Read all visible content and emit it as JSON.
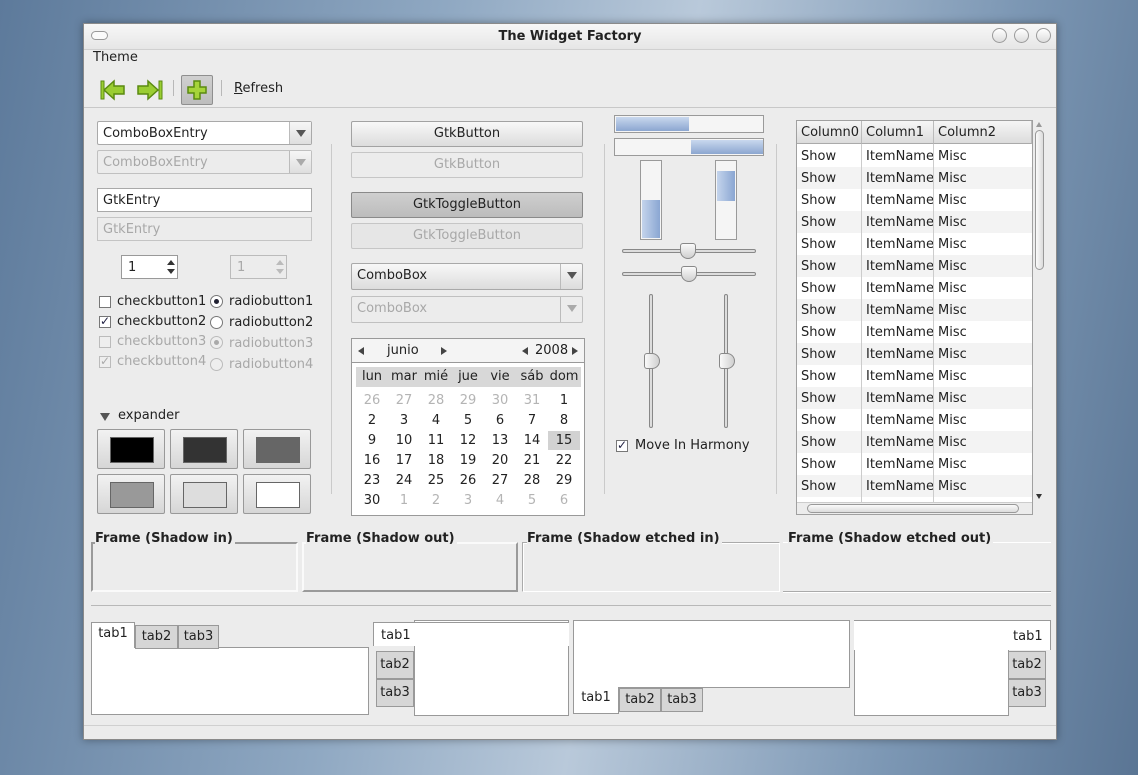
{
  "window": {
    "title": "The Widget Factory"
  },
  "menu": {
    "theme": "Theme"
  },
  "toolbar": {
    "refresh": "Refresh"
  },
  "left": {
    "combo1": "ComboBoxEntry",
    "combo2": "ComboBoxEntry",
    "entry1": "GtkEntry",
    "entry2": "GtkEntry",
    "spin1": "1",
    "spin2": "1",
    "check1": "checkbutton1",
    "check2": "checkbutton2",
    "check3": "checkbutton3",
    "check4": "checkbutton4",
    "radio1": "radiobutton1",
    "radio2": "radiobutton2",
    "radio3": "radiobutton3",
    "radio4": "radiobutton4",
    "expander": "expander",
    "swatch_colors": [
      "#000000",
      "#333333",
      "#666666",
      "#999999",
      "#dddddd",
      "#ffffff"
    ]
  },
  "middle": {
    "button1": "GtkButton",
    "button2": "GtkButton",
    "toggle1": "GtkToggleButton",
    "toggle2": "GtkToggleButton",
    "combo1": "ComboBox",
    "combo2": "ComboBox"
  },
  "calendar": {
    "month": "junio",
    "year": "2008",
    "days": [
      "lun",
      "mar",
      "mié",
      "jue",
      "vie",
      "sáb",
      "dom"
    ],
    "selected": "15",
    "weeks": [
      [
        "26",
        "27",
        "28",
        "29",
        "30",
        "31",
        "1"
      ],
      [
        "2",
        "3",
        "4",
        "5",
        "6",
        "7",
        "8"
      ],
      [
        "9",
        "10",
        "11",
        "12",
        "13",
        "14",
        "15"
      ],
      [
        "16",
        "17",
        "18",
        "19",
        "20",
        "21",
        "22"
      ],
      [
        "23",
        "24",
        "25",
        "26",
        "27",
        "28",
        "29"
      ],
      [
        "30",
        "1",
        "2",
        "3",
        "4",
        "5",
        "6"
      ]
    ]
  },
  "sliders": {
    "move_in_harmony": "Move In Harmony",
    "progress_h1": 0.5,
    "progress_v1": 0.5
  },
  "tree": {
    "columns": [
      "Column0",
      "Column1",
      "Column2"
    ],
    "rows": [
      [
        "Show",
        "ItemName",
        "Misc"
      ],
      [
        "Show",
        "ItemName",
        "Misc"
      ],
      [
        "Show",
        "ItemName",
        "Misc"
      ],
      [
        "Show",
        "ItemName",
        "Misc"
      ],
      [
        "Show",
        "ItemName",
        "Misc"
      ],
      [
        "Show",
        "ItemName",
        "Misc"
      ],
      [
        "Show",
        "ItemName",
        "Misc"
      ],
      [
        "Show",
        "ItemName",
        "Misc"
      ],
      [
        "Show",
        "ItemName",
        "Misc"
      ],
      [
        "Show",
        "ItemName",
        "Misc"
      ],
      [
        "Show",
        "ItemName",
        "Misc"
      ],
      [
        "Show",
        "ItemName",
        "Misc"
      ],
      [
        "Show",
        "ItemName",
        "Misc"
      ],
      [
        "Show",
        "ItemName",
        "Misc"
      ],
      [
        "Show",
        "ItemName",
        "Misc"
      ],
      [
        "Show",
        "ItemName",
        "Misc"
      ]
    ]
  },
  "frames": {
    "f1": "Frame (Shadow in)",
    "f2": "Frame (Shadow out)",
    "f3": "Frame (Shadow etched in)",
    "f4": "Frame (Shadow etched out)"
  },
  "tabs": {
    "t1": "tab1",
    "t2": "tab2",
    "t3": "tab3"
  }
}
